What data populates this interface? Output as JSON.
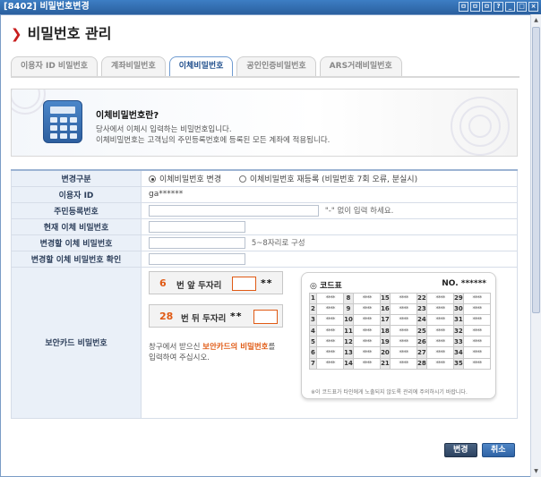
{
  "window": {
    "title": "[8402] 비밀번호변경",
    "buttons": [
      "ㅁ",
      "ㅁ",
      "ㅁ",
      "?",
      "_",
      "□",
      "×"
    ]
  },
  "page": {
    "title": "비밀번호 관리"
  },
  "tabs": [
    {
      "label": "이용자 ID 비밀번호",
      "active": false
    },
    {
      "label": "계좌비밀번호",
      "active": false
    },
    {
      "label": "이체비밀번호",
      "active": true
    },
    {
      "label": "공인인증비밀번호",
      "active": false
    },
    {
      "label": "ARS거래비밀번호",
      "active": false
    }
  ],
  "info": {
    "title": "이체비밀번호란?",
    "line1": "당사에서 이체시 입력하는 비밀번호입니다.",
    "line2": "이체비밀번호는 고객님의 주민등록번호에 등록된 모든 계좌에 적용됩니다."
  },
  "form": {
    "change_type": {
      "label": "변경구분",
      "option1": "이체비밀번호 변경",
      "option2": "이체비밀번호 재등록 (비밀번호 7회 오류, 분실시)"
    },
    "user_id": {
      "label": "이용자 ID",
      "value": "ga******"
    },
    "resident_no": {
      "label": "주민등록번호",
      "hint": "\"-\" 없이 입력 하세요."
    },
    "current_pw": {
      "label": "현재 이체 비밀번호"
    },
    "new_pw": {
      "label": "변경할 이체 비밀번호",
      "hint": "5~8자리로 구성"
    },
    "confirm_pw": {
      "label": "변경할 이체 비밀번호 확인"
    },
    "security_card": {
      "label": "보안카드 비밀번호",
      "row1": {
        "num": "6",
        "text": "번 앞 두자리",
        "stars": "**"
      },
      "row2": {
        "num": "28",
        "text": "번 뒤 두자리",
        "stars": "**"
      },
      "note_prefix": "창구에서 받으신 ",
      "note_highlight": "보안카드의 비밀번호",
      "note_suffix": "를",
      "note_line2": "입력하여 주십시오."
    }
  },
  "card": {
    "title": "코드표",
    "number": "NO. ******",
    "rows": [
      [
        1,
        8,
        15,
        22,
        29
      ],
      [
        2,
        9,
        16,
        23,
        30
      ],
      [
        3,
        10,
        17,
        24,
        31
      ],
      [
        4,
        11,
        18,
        25,
        32
      ],
      [
        5,
        12,
        19,
        26,
        33
      ],
      [
        6,
        13,
        20,
        27,
        34
      ],
      [
        7,
        14,
        21,
        28,
        35
      ]
    ],
    "mask": "****",
    "note": "※이 코드표가 타인에게 노출되지 않도록 관리에 주의하시기 바랍니다."
  },
  "buttons": {
    "confirm": "변경",
    "cancel": "취소"
  }
}
